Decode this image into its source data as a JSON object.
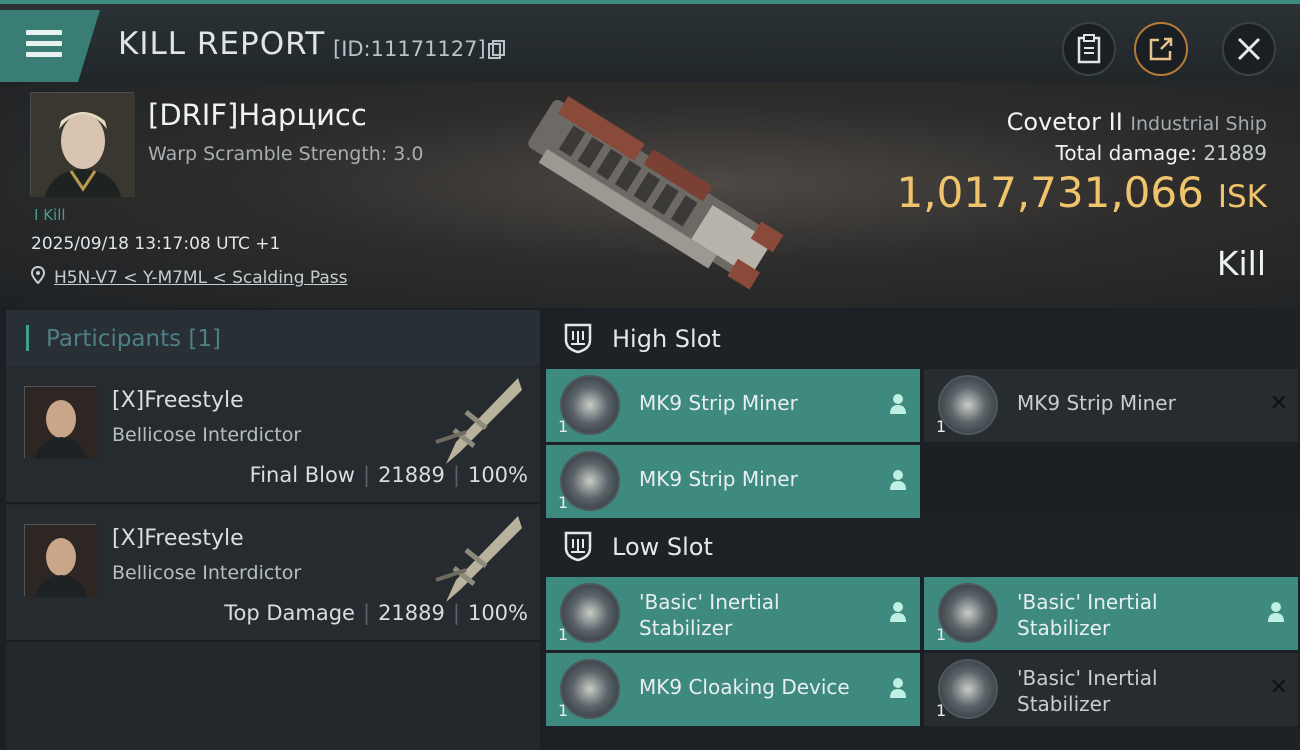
{
  "header": {
    "title": "KILL REPORT",
    "report_id": "[ID:11171127]"
  },
  "victim": {
    "name": "[DRIF]Нарцисс",
    "warp_scramble": "Warp Scramble Strength: 3.0",
    "kill_count_label": "I Kill",
    "datetime": "2025/09/18 13:17:08 UTC +1",
    "location": "H5N-V7 < Y-M7ML < Scalding Pass",
    "ship_name": "Covetor II",
    "ship_class": "Industrial Ship",
    "total_damage_label": "Total damage:",
    "total_damage": "21889",
    "isk_value": "1,017,731,066",
    "isk_currency": "ISK",
    "outcome": "Kill"
  },
  "participants": {
    "title": "Participants",
    "count": "[1]",
    "cards": [
      {
        "name": "[X]Freestyle",
        "ship": "Bellicose Interdictor",
        "role": "Final Blow",
        "damage": "21889",
        "percent": "100%"
      },
      {
        "name": "[X]Freestyle",
        "ship": "Bellicose Interdictor",
        "role": "Top Damage",
        "damage": "21889",
        "percent": "100%"
      }
    ]
  },
  "slots": {
    "high": {
      "title": "High Slot",
      "modules": [
        {
          "name": "MK9 Strip Miner",
          "qty": "1",
          "state": "dropped"
        },
        {
          "name": "MK9 Strip Miner",
          "qty": "1",
          "state": "destroyed"
        },
        {
          "name": "MK9 Strip Miner",
          "qty": "1",
          "state": "dropped"
        }
      ]
    },
    "low": {
      "title": "Low Slot",
      "modules": [
        {
          "name": "'Basic' Inertial Stabilizer",
          "qty": "1",
          "state": "dropped"
        },
        {
          "name": "'Basic' Inertial Stabilizer",
          "qty": "1",
          "state": "dropped"
        },
        {
          "name": "MK9 Cloaking Device",
          "qty": "1",
          "state": "dropped"
        },
        {
          "name": "'Basic' Inertial Stabilizer",
          "qty": "1",
          "state": "destroyed"
        }
      ]
    }
  },
  "icons": {
    "menu": "hamburger-menu-icon",
    "copy": "copy-icon",
    "clipboard": "clipboard-icon",
    "share": "share-icon",
    "close": "close-icon",
    "location": "location-pin-icon",
    "slot": "slot-shield-icon",
    "person": "person-icon",
    "destroyed": "x-mark-icon"
  },
  "colors": {
    "accent": "#3e8a7e",
    "isk": "#f0c46c",
    "share_ring": "#b87a3c"
  }
}
